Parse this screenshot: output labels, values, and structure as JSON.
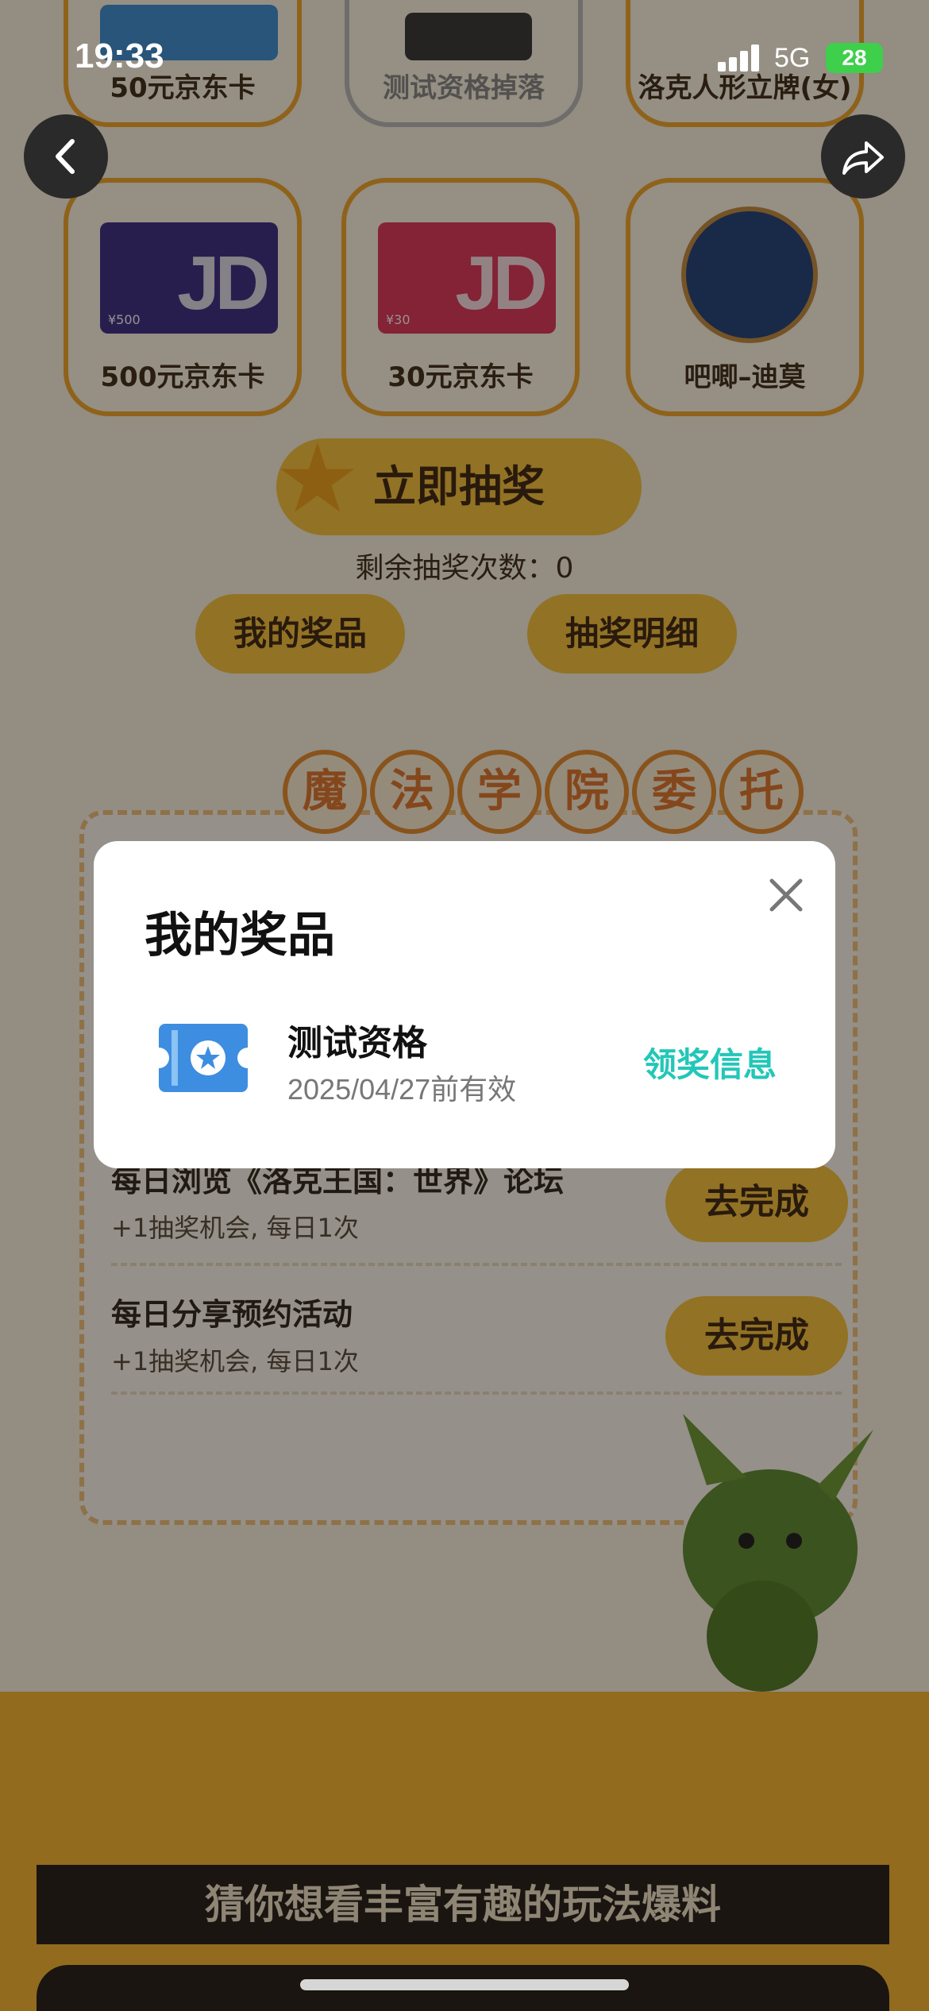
{
  "status_bar": {
    "time": "19:33",
    "network": "5G",
    "battery": "28"
  },
  "nav": {
    "back_icon": "chevron-left-icon",
    "share_icon": "share-arrow-icon"
  },
  "prizes": [
    {
      "name": "50元京东卡"
    },
    {
      "name": "测试资格掉落"
    },
    {
      "name": "洛克人形立牌(女)"
    },
    {
      "name": "500元京东卡",
      "card_text": "JD",
      "card_value": "¥500"
    },
    {
      "name": "30元京东卡",
      "card_text": "JD",
      "card_value": "¥30"
    },
    {
      "name": "吧唧–迪莫"
    }
  ],
  "draw": {
    "button_label": "立即抽奖",
    "remaining": "剩余抽奖次数：0"
  },
  "actions": {
    "my_prizes": "我的奖品",
    "draw_details": "抽奖明细"
  },
  "section_title": [
    "魔",
    "法",
    "学",
    "院",
    "委",
    "托"
  ],
  "tasks": [
    {
      "title": "每日浏览《洛克王国：世界》论坛",
      "sub": "+1抽奖机会, 每日1次",
      "button": "去完成"
    },
    {
      "title": "每日分享预约活动",
      "sub": "+1抽奖机会, 每日1次",
      "button": "去完成"
    }
  ],
  "banner": "猜你想看丰富有趣的玩法爆料",
  "modal": {
    "title": "我的奖品",
    "item_name": "测试资格",
    "item_validity": "2025/04/27前有效",
    "claim_label": "领奖信息"
  },
  "colors": {
    "accent_yellow": "#f9c43a",
    "link_teal": "#22c7b8",
    "jd_purple": "#3a2a86",
    "jd_red": "#e0325a"
  }
}
